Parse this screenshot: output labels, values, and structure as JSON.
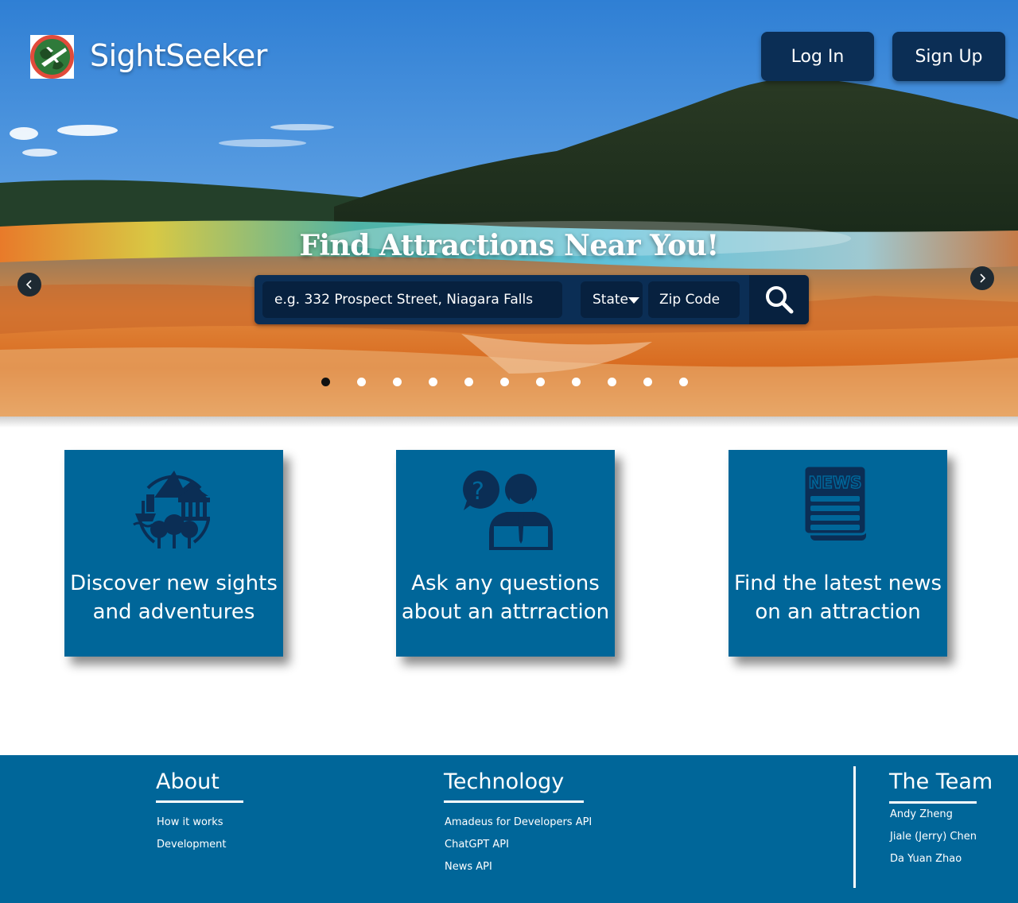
{
  "header": {
    "brand": "SightSeeker",
    "login_label": "Log In",
    "signup_label": "Sign Up"
  },
  "hero": {
    "title": "Find Attractions Near You!",
    "search_placeholder": "e.g. 332 Prospect Street, Niagara Falls",
    "state_label": "State",
    "zip_placeholder": "Zip Code",
    "slide_count": 11,
    "active_slide": 1
  },
  "features": [
    {
      "text_line1": "Discover new sights",
      "text_line2": "and adventures",
      "icon": "landmarks-globe-icon"
    },
    {
      "text_line1": "Ask any questions",
      "text_line2": "about an attrraction",
      "icon": "question-person-icon"
    },
    {
      "text_line1": "Find the latest news",
      "text_line2": "on an attraction",
      "icon": "newspaper-icon"
    }
  ],
  "footer": {
    "about": {
      "heading": "About",
      "links": [
        "How it works",
        "Development"
      ]
    },
    "technology": {
      "heading": "Technology",
      "links": [
        "Amadeus for Developers API",
        "ChatGPT API",
        "News API"
      ]
    },
    "team": {
      "heading": "The Team",
      "members": [
        "Andy Zheng",
        "Jiale (Jerry) Chen",
        "Da Yuan Zhao"
      ]
    }
  },
  "colors": {
    "navy": "#0b2e55",
    "card_blue": "#006699",
    "footer_blue": "#006699"
  }
}
